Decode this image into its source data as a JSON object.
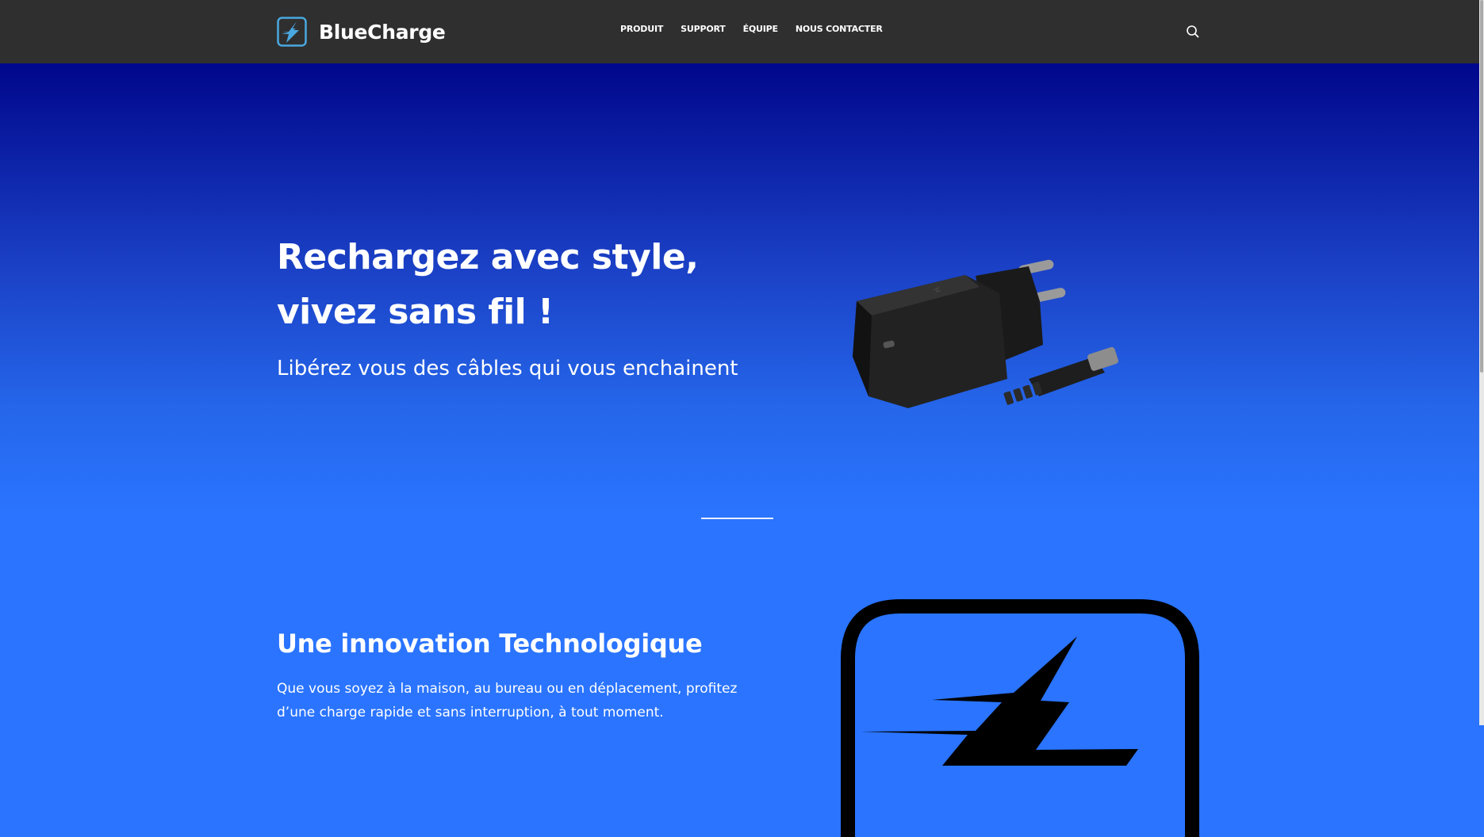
{
  "header": {
    "brand_name": "BlueCharge",
    "logo_icon": "lightning-bolt-icon",
    "nav": [
      "PRODUIT",
      "SUPPORT",
      "ÉQUIPE",
      "NOUS CONTACTER"
    ],
    "search_icon": "search-icon"
  },
  "hero": {
    "title": "Rechargez avec style, vivez sans fil !",
    "subtitle": "Libérez vous des câbles qui vous enchainent",
    "image": "usb-c-charger-with-cable"
  },
  "section": {
    "title": "Une innovation Technologique",
    "text": "Que vous soyez à la maison, au bureau ou en déplacement, profitez d’une charge rapide et sans interruption, à tout moment.",
    "image": "lightning-bolt-logo"
  },
  "colors": {
    "topbar": "#2f2f2f",
    "gradient_top": "#00078c",
    "gradient_bottom": "#2a74ff",
    "logo_accent": "#4aa8e0",
    "text": "#ffffff"
  }
}
